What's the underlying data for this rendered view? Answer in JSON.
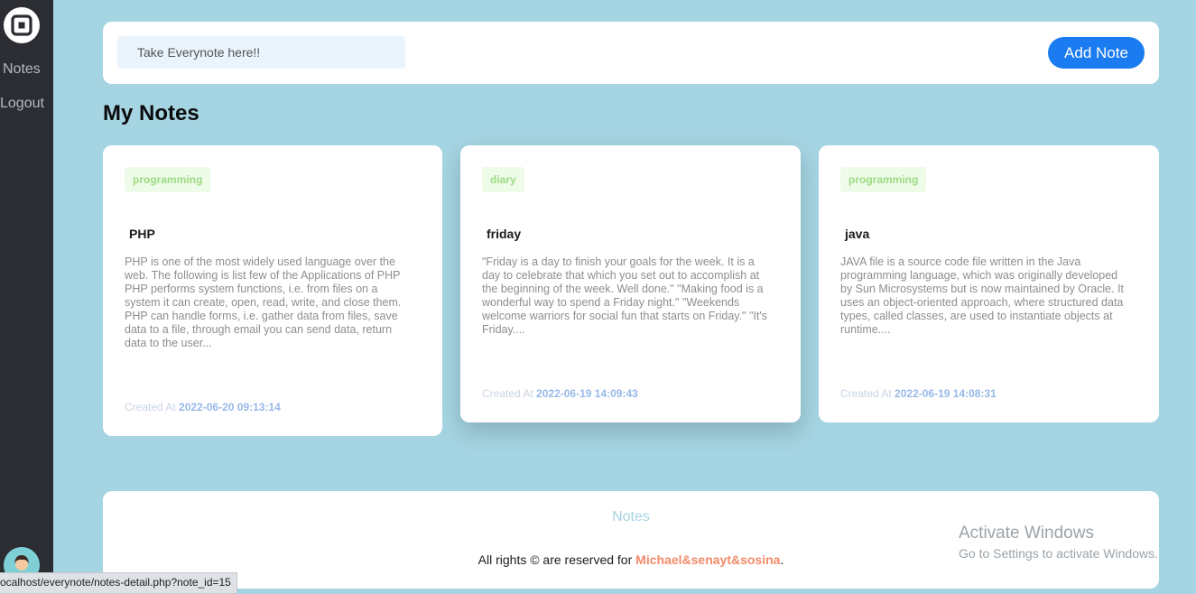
{
  "sidebar": {
    "logo_icon": "square-logo-icon",
    "items": [
      {
        "label": "Notes"
      },
      {
        "label": "Logout"
      }
    ],
    "avatar_icon": "user-avatar-icon"
  },
  "status_bar": {
    "url": "ocalhost/everynote/notes-detail.php?note_id=15"
  },
  "composer": {
    "placeholder": "Take Everynote here!!",
    "add_label": "Add Note"
  },
  "main": {
    "title": "My Notes",
    "notes": [
      {
        "tag": "programming",
        "title": "PHP",
        "body": "PHP is one of the most widely used language over the web. The following is list few of the Applications of PHP PHP performs system functions, i.e. from files on a system it can create, open, read, write, and close them. PHP can handle forms, i.e. gather data from files, save data to a file, through email you can send data, return data to the user...",
        "created_label": "Created At",
        "created_at": "2022-06-20 09:13:14"
      },
      {
        "tag": "diary",
        "title": "friday",
        "body": "\"Friday is a day to finish your goals for the week. It is a day to celebrate that which you set out to accomplish at the beginning of the week. Well done.\" \"Making food is a wonderful way to spend a Friday night.\" \"Weekends welcome warriors for social fun that starts on Friday.\" \"It's Friday....",
        "created_label": "Created At",
        "created_at": "2022-06-19 14:09:43"
      },
      {
        "tag": "programming",
        "title": "java",
        "body": "JAVA file is a source code file written in the Java programming language, which was originally developed by Sun Microsystems but is now maintained by Oracle. It uses an object-oriented approach, where structured data types, called classes, are used to instantiate objects at runtime....",
        "created_label": "Created At",
        "created_at": "2022-06-19 14:08:31"
      }
    ]
  },
  "footer": {
    "brand": "Notes",
    "rights_prefix": "All rights © are reserved for",
    "authors": "Michael&senayt&sosina",
    "suffix": "."
  },
  "watermark": {
    "line1": "Activate Windows",
    "line2": "Go to Settings to activate Windows."
  },
  "colors": {
    "page_bg": "#a5d4e2",
    "sidebar_bg": "#2b2d33",
    "accent_button": "#1a7cf0",
    "tag_text": "#9ddb82",
    "tag_bg": "#edfbe8",
    "date_text": "#98b8e8",
    "authors_text": "#f48a69"
  }
}
